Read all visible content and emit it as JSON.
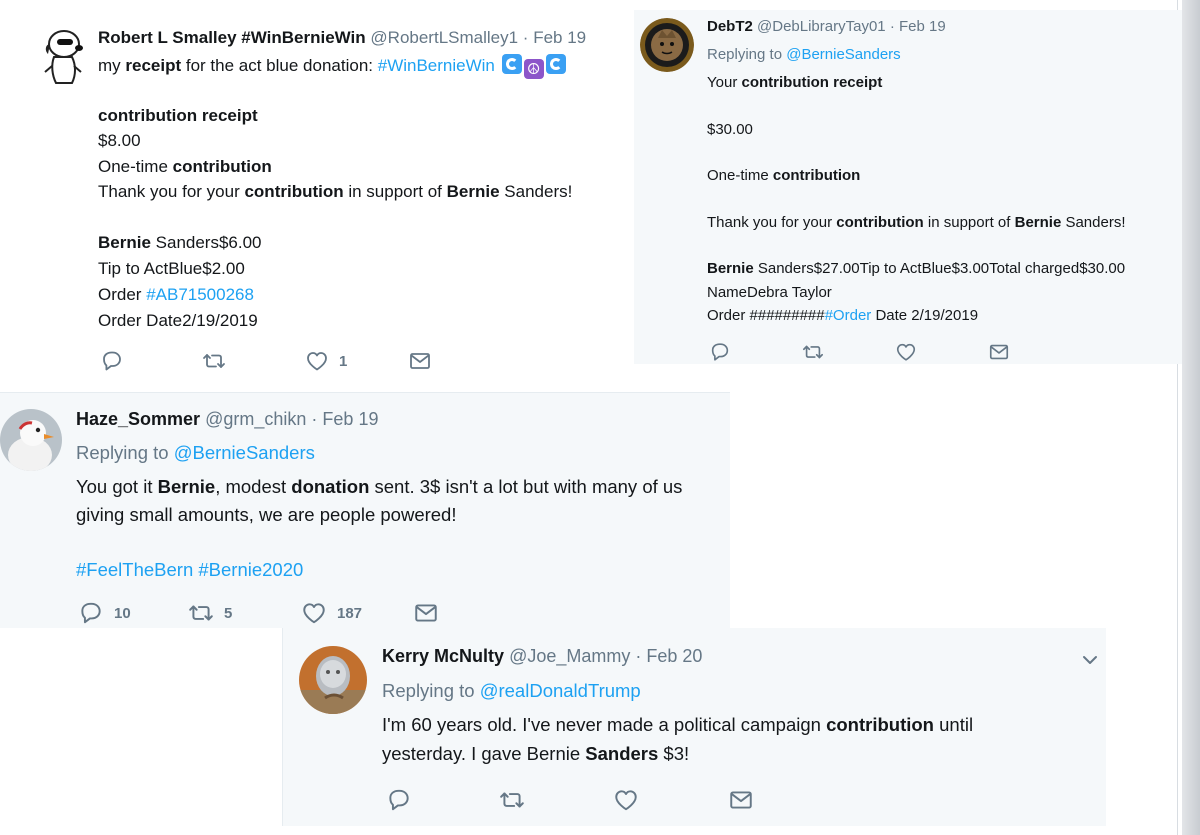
{
  "tweets": {
    "t1": {
      "name": "Robert L Smalley #WinBernieWin",
      "handle": "@RobertLSmalley1",
      "dot": "·",
      "date": "Feb 19",
      "text_a": "my ",
      "text_b": "receipt",
      "text_c": " for the act blue donation: ",
      "hashtag": "#WinBernieWin",
      "emojis": [
        "wave",
        "peace",
        "wave"
      ],
      "receipt_title_a": "contribution",
      "receipt_title_b": " receipt",
      "amount": "$8.00",
      "onetime_a": "One-time ",
      "onetime_b": "contribution",
      "thanks_a": "Thank you for your ",
      "thanks_b": "contribution",
      "thanks_c": " in support of ",
      "thanks_d": "Bernie",
      "thanks_e": " Sanders!",
      "bs_a": "Bernie",
      "bs_b": " Sanders$6.00",
      "tip": "Tip to ActBlue$2.00",
      "order_a": "Order ",
      "order_b": "#AB71500268",
      "order_date": "Order Date2/19/2019",
      "likes": "1"
    },
    "t2": {
      "name": "DebT2",
      "handle": "@DebLibraryTay01",
      "dot": "·",
      "date": "Feb 19",
      "reply_a": "Replying to ",
      "reply_b": "@BernieSanders",
      "your_a": "Your ",
      "your_b": "contribution receipt",
      "amount": "$30.00",
      "onetime_a": "One-time ",
      "onetime_b": "contribution",
      "thanks_a": "Thank you for your ",
      "thanks_b": "contribution",
      "thanks_c": " in support of ",
      "thanks_d": "Bernie",
      "thanks_e": " Sanders!",
      "bs_a": "Bernie",
      "bs_b": " Sanders$27.00Tip to ActBlue$3.00Total charged$30.00",
      "namedebra": "NameDebra Taylor",
      "order_a": "Order #########",
      "order_b": "#Order",
      "order_c": " Date 2/19/2019"
    },
    "t3": {
      "name": "Haze_Sommer",
      "handle": "@grm_chikn",
      "dot": "·",
      "date": "Feb 19",
      "reply_a": "Replying to ",
      "reply_b": "@BernieSanders",
      "l1_a": "You got it ",
      "l1_b": "Bernie",
      "l1_c": ", modest ",
      "l1_d": "donation",
      "l1_e": " sent. 3$ isn't a lot but with many of us",
      "l2": "giving small amounts, we are people powered!",
      "hashtags": "#FeelTheBern #Bernie2020",
      "replies": "10",
      "retweets": "5",
      "likes": "187"
    },
    "t4": {
      "name": "Kerry McNulty",
      "handle": "@Joe_Mammy",
      "dot": "·",
      "date": "Feb 20",
      "reply_a": "Replying to ",
      "reply_b": "@realDonaldTrump",
      "l1_a": "I'm 60 years old. I've never made a political campaign ",
      "l1_b": "contribution",
      "l1_c": " until",
      "l2_a": "yesterday. I gave Bernie ",
      "l2_b": "Sanders",
      "l2_c": " $3!"
    }
  },
  "colors": {
    "link": "#1da1f2",
    "muted": "#657786",
    "text": "#14171a",
    "panel": "#f5f8fa"
  }
}
